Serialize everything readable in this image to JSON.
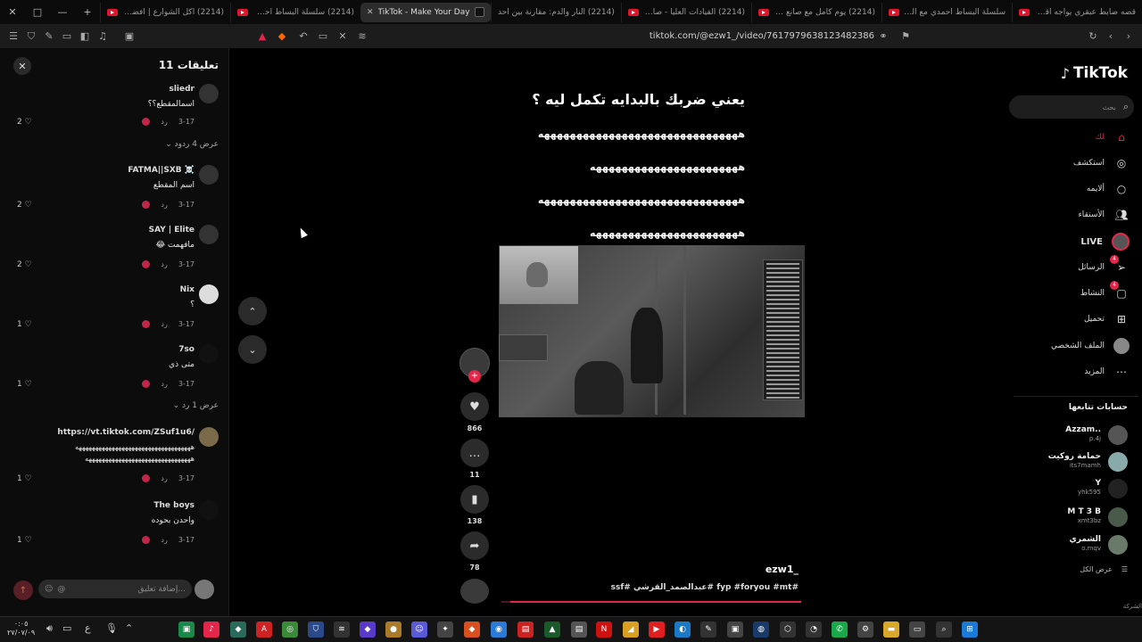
{
  "browser": {
    "tabs": [
      {
        "title": "قصه ضابط عبقري يواجه اقوى ال",
        "active": false
      },
      {
        "title": "سلسلة البساط أحمدي مع الشيخ",
        "active": false
      },
      {
        "title": "(2214) يوم كامل مع صانع في كر",
        "active": false
      },
      {
        "title": "(2214) القيادات العليا - صابعة",
        "active": false
      },
      {
        "title": "(2214) النار والدم: مقارنة بين أحد",
        "active": false
      },
      {
        "title": "TikTok - Make Your Day",
        "active": true
      },
      {
        "title": "(2214) سلسلة البساط أحمدي #3",
        "active": false
      },
      {
        "title": "(2214) أكل الشوارع | أفضل شاو",
        "active": false
      }
    ],
    "new_tab": "+",
    "url": "tiktok.com/@ezw1_/video/7617979638123482386"
  },
  "comments_panel": {
    "title": "تعليقات 11",
    "close": "✕",
    "reply_label": "رد",
    "comments": [
      {
        "user": "sliedr",
        "text": "اسمالمقطع؟؟",
        "date": "3-17",
        "likes": "2"
      },
      {
        "user": "FATMA||SXB ☠️",
        "text": "اسم المقطع",
        "date": "3-17",
        "likes": "2"
      },
      {
        "user": "SAY | Elite",
        "text": "مافهمت 😂",
        "date": "3-17",
        "likes": "2"
      },
      {
        "user": "Nix",
        "text": "؟",
        "date": "3-17",
        "likes": "1"
      },
      {
        "user": "7so",
        "text": "متى ذي",
        "date": "3-17",
        "likes": "1"
      },
      {
        "user": "https://vt.tiktok.com/ZSuf1u6/",
        "text": "هههههههههههههههههههههههههههههههههههه",
        "text2": "ههههههههههههههههههههههههههههههههه",
        "date": "3-17",
        "likes": "1"
      },
      {
        "user": "The boys",
        "text": "واحدن بحوده",
        "date": "3-17",
        "likes": "1"
      }
    ],
    "replies": [
      {
        "label": "عرض 4 ردود"
      },
      {
        "label": "عرض 1 رد"
      }
    ],
    "composer_placeholder": "إضافة تعليق...",
    "at_symbol": "@",
    "emoji_symbol": "☺",
    "send_symbol": "↑"
  },
  "video": {
    "title": "يعني ضربك بالبدايه تكمل ليه ؟",
    "lines": [
      "هههههههههههههههههههههههههههههههه",
      "هههههههههههههههههههههههه",
      "هههههههههههههههههههههههههههههههه",
      "هههههههههههههههههههههههه"
    ],
    "author": "ezw1_",
    "description": "#fyp #foryou #mt #عبدالصمد_القرشي #ssf",
    "progress": 0.97,
    "likes": "866",
    "comments": "11",
    "saves": "138",
    "shares": "78"
  },
  "sidebar": {
    "logo": "TikTok",
    "search_placeholder": "بحث",
    "nav": [
      {
        "label": "لك",
        "icon": "home-icon"
      },
      {
        "label": "استكشف",
        "icon": "compass-icon"
      },
      {
        "label": "ألايمه",
        "icon": "circle-icon"
      },
      {
        "label": "الأستقاء",
        "icon": "users-icon"
      },
      {
        "label": "LIVE",
        "icon": "live-icon"
      },
      {
        "label": "الرسائل",
        "icon": "send-icon",
        "badge": "4"
      },
      {
        "label": "النشاط",
        "icon": "message-icon",
        "badge": "4"
      },
      {
        "label": "تحميل",
        "icon": "plus-square-icon"
      },
      {
        "label": "الملف الشخصي",
        "icon": "profile-icon"
      },
      {
        "label": "المزيد",
        "icon": "more-icon"
      }
    ],
    "following_title": "حسابات تتابعها",
    "accounts": [
      {
        "name": "Azzam..",
        "handle": "p.4j"
      },
      {
        "name": "حمامة روكيت",
        "handle": "its7mamh"
      },
      {
        "name": "Y",
        "handle": "yhk595"
      },
      {
        "name": "M T 3 B",
        "handle": "xmt3bz"
      },
      {
        "name": "الشمري",
        "handle": "o.mqv"
      }
    ],
    "see_all": "عرض الكل",
    "companies": "الشركة"
  },
  "taskbar": {
    "time": "٠:٠٥",
    "date": "٢٧/٠٧/٠٩",
    "lang": "ع"
  },
  "colors": {
    "accent": "#e3264a",
    "background": "#000000"
  }
}
